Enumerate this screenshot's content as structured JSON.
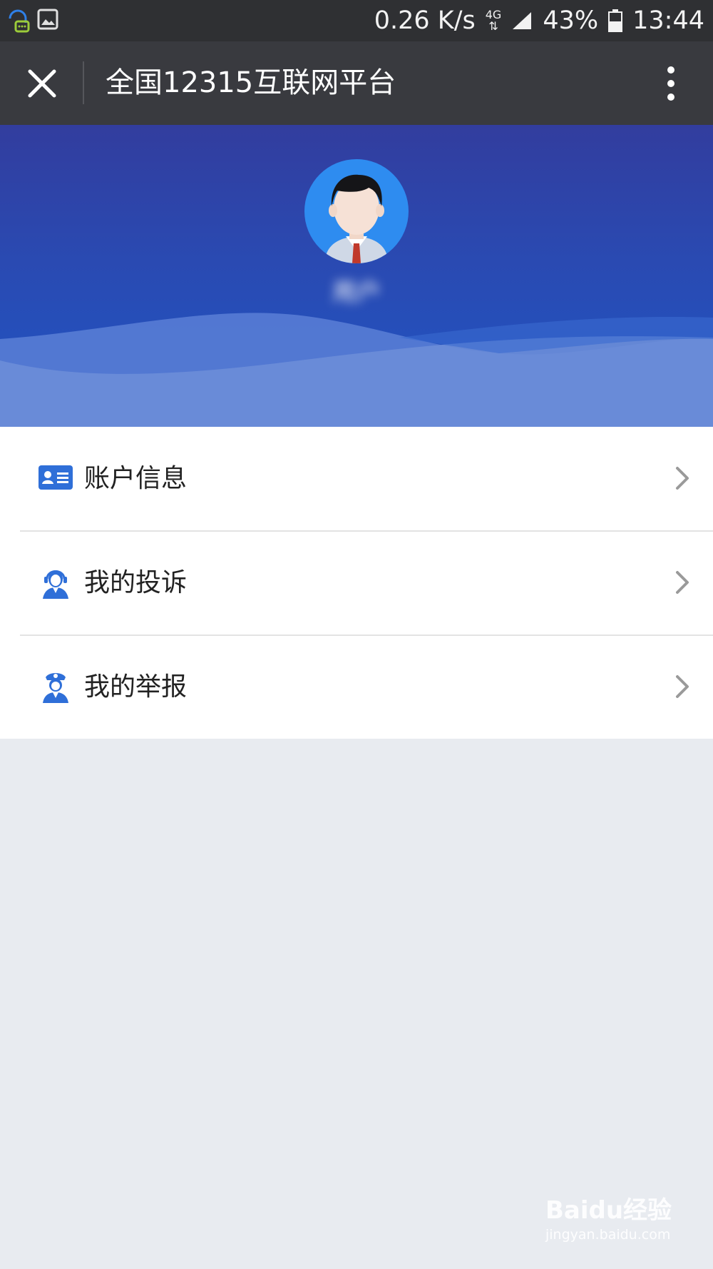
{
  "status_bar": {
    "speed": "0.26 K/s",
    "network": "4G",
    "battery": "43%",
    "time": "13:44"
  },
  "nav": {
    "title": "全国12315互联网平台"
  },
  "profile": {
    "username": "用户"
  },
  "menu": {
    "items": [
      {
        "label": "账户信息",
        "icon": "id-card-icon"
      },
      {
        "label": "我的投诉",
        "icon": "customer-service-icon"
      },
      {
        "label": "我的举报",
        "icon": "police-officer-icon"
      }
    ]
  },
  "watermark": {
    "brand": "Baidu经验",
    "url": "jingyan.baidu.com"
  },
  "colors": {
    "accent": "#2f6fd8",
    "hero_top": "#323d9e",
    "hero_bottom": "#1f55c4",
    "page_background": "#e8ebf0"
  }
}
